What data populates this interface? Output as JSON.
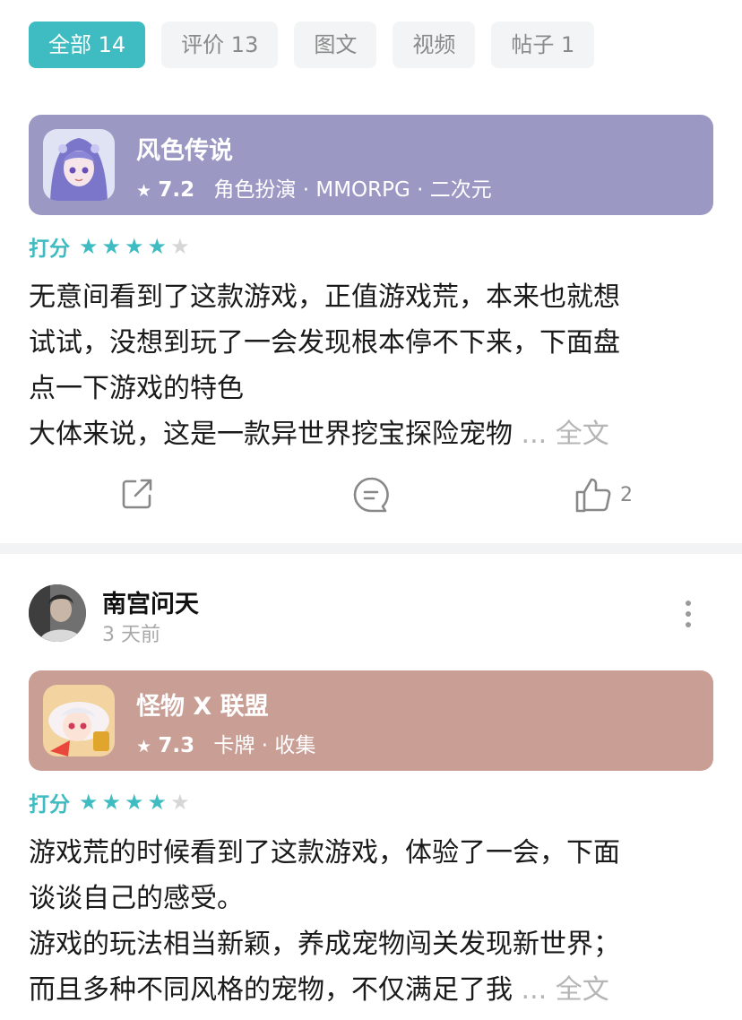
{
  "tabs": [
    {
      "label": "全部 14",
      "active": true
    },
    {
      "label": "评价 13",
      "active": false
    },
    {
      "label": "图文",
      "active": false
    },
    {
      "label": "视频",
      "active": false
    },
    {
      "label": "帖子 1",
      "active": false
    }
  ],
  "posts": [
    {
      "game": {
        "name": "风色传说",
        "star": "★",
        "score": "7.2",
        "tags": "角色扮演 · MMORPG · 二次元",
        "card_color": "#9b98c4"
      },
      "rating_label": "打分",
      "stars_filled": 4,
      "stars_total": 5,
      "text_lines": [
        "无意间看到了这款游戏，正值游戏荒，本来也就想",
        "试试，没想到玩了一会发现根本停不下来，下面盘",
        "点一下游戏的特色",
        "大体来说，这是一款异世界挖宝探险宠物"
      ],
      "more": "... 全文",
      "likes": "2"
    },
    {
      "user": {
        "name": "南宫问天",
        "time": "3 天前"
      },
      "game": {
        "name": "怪物 X 联盟",
        "star": "★",
        "score": "7.3",
        "tags": "卡牌 · 收集",
        "card_color": "#c99e95"
      },
      "rating_label": "打分",
      "stars_filled": 4,
      "stars_total": 5,
      "text_lines": [
        "游戏荒的时候看到了这款游戏，体验了一会，下面",
        "谈谈自己的感受。",
        "游戏的玩法相当新颖，养成宠物闯关发现新世界；",
        "而且多种不同风格的宠物，不仅满足了我"
      ],
      "more": "... 全文"
    }
  ]
}
